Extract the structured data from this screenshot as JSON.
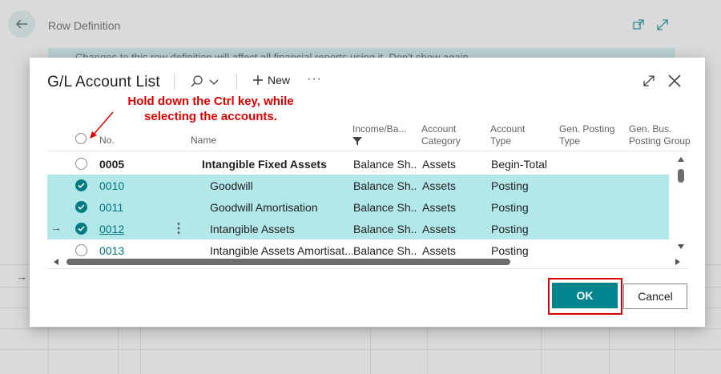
{
  "background": {
    "page_title": "Row Definition",
    "banner_text": "Changes to this row definition will affect all financial reports using it.    Don't show again"
  },
  "dialog": {
    "title": "G/L Account List",
    "toolbar": {
      "new_label": "New",
      "more_label": "···"
    },
    "annotation": {
      "line1": "Hold down the Ctrl key, while",
      "line2": "selecting the accounts."
    },
    "columns": {
      "no": "No.",
      "name": "Name",
      "income_balance": "Income/Ba...",
      "account_category_1": "Account",
      "account_category_2": "Category",
      "account_type_1": "Account",
      "account_type_2": "Type",
      "gen_posting_type_1": "Gen. Posting",
      "gen_posting_type_2": "Type",
      "gen_bus_posting_group_1": "Gen. Bus.",
      "gen_bus_posting_group_2": "Posting Group"
    },
    "rows": [
      {
        "no": "0005",
        "name": "Intangible Fixed Assets",
        "income_balance": "Balance Sh...",
        "category": "Assets",
        "type": "Begin-Total"
      },
      {
        "no": "0010",
        "name": "Goodwill",
        "income_balance": "Balance Sh...",
        "category": "Assets",
        "type": "Posting"
      },
      {
        "no": "0011",
        "name": "Goodwill Amortisation",
        "income_balance": "Balance Sh...",
        "category": "Assets",
        "type": "Posting"
      },
      {
        "no": "0012",
        "name": "Intangible Assets",
        "income_balance": "Balance Sh...",
        "category": "Assets",
        "type": "Posting"
      },
      {
        "no": "0013",
        "name": "Intangible Assets Amortisat...",
        "income_balance": "Balance Sh...",
        "category": "Assets",
        "type": "Posting"
      }
    ],
    "buttons": {
      "ok": "OK",
      "cancel": "Cancel"
    }
  },
  "colors": {
    "accent": "#00858e",
    "selected_row": "#b3e8eb",
    "annotation": "#e00000"
  }
}
